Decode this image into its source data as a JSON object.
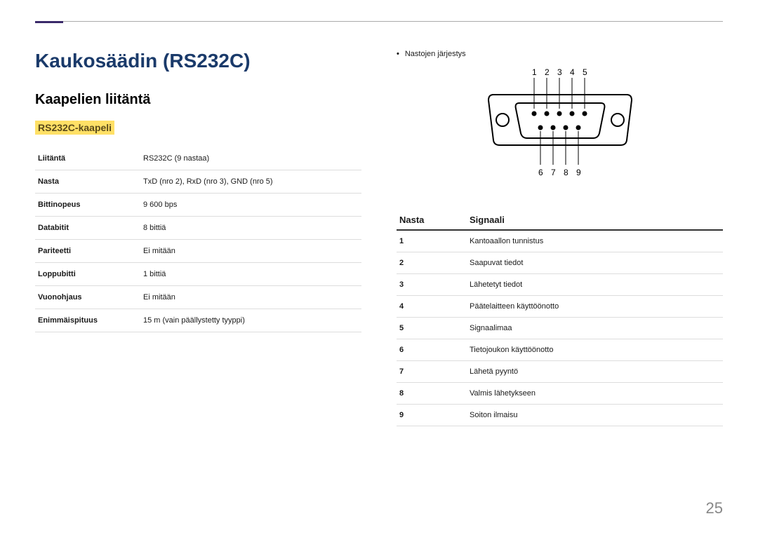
{
  "title": "Kaukosäädin (RS232C)",
  "section": "Kaapelien liitäntä",
  "subsection": "RS232C-kaapeli",
  "specs": [
    {
      "label": "Liitäntä",
      "value": "RS232C (9 nastaa)"
    },
    {
      "label": "Nasta",
      "value": "TxD (nro 2), RxD (nro 3), GND (nro 5)"
    },
    {
      "label": "Bittinopeus",
      "value": "9 600 bps"
    },
    {
      "label": "Databitit",
      "value": "8 bittiä"
    },
    {
      "label": "Pariteetti",
      "value": "Ei mitään"
    },
    {
      "label": "Loppubitti",
      "value": "1 bittiä"
    },
    {
      "label": "Vuonohjaus",
      "value": "Ei mitään"
    },
    {
      "label": "Enimmäispituus",
      "value": "15 m (vain päällystetty tyyppi)"
    }
  ],
  "pin_note": "Nastojen järjestys",
  "sig_header": {
    "c1": "Nasta",
    "c2": "Signaali"
  },
  "signals": [
    {
      "pin": "1",
      "sig": "Kantoaallon tunnistus"
    },
    {
      "pin": "2",
      "sig": "Saapuvat tiedot"
    },
    {
      "pin": "3",
      "sig": "Lähetetyt tiedot"
    },
    {
      "pin": "4",
      "sig": "Päätelaitteen käyttöönotto"
    },
    {
      "pin": "5",
      "sig": "Signaalimaa"
    },
    {
      "pin": "6",
      "sig": "Tietojoukon käyttöönotto"
    },
    {
      "pin": "7",
      "sig": "Lähetä pyyntö"
    },
    {
      "pin": "8",
      "sig": "Valmis lähetykseen"
    },
    {
      "pin": "9",
      "sig": "Soiton ilmaisu"
    }
  ],
  "pins_top": [
    "1",
    "2",
    "3",
    "4",
    "5"
  ],
  "pins_bottom": [
    "6",
    "7",
    "8",
    "9"
  ],
  "page_number": "25"
}
